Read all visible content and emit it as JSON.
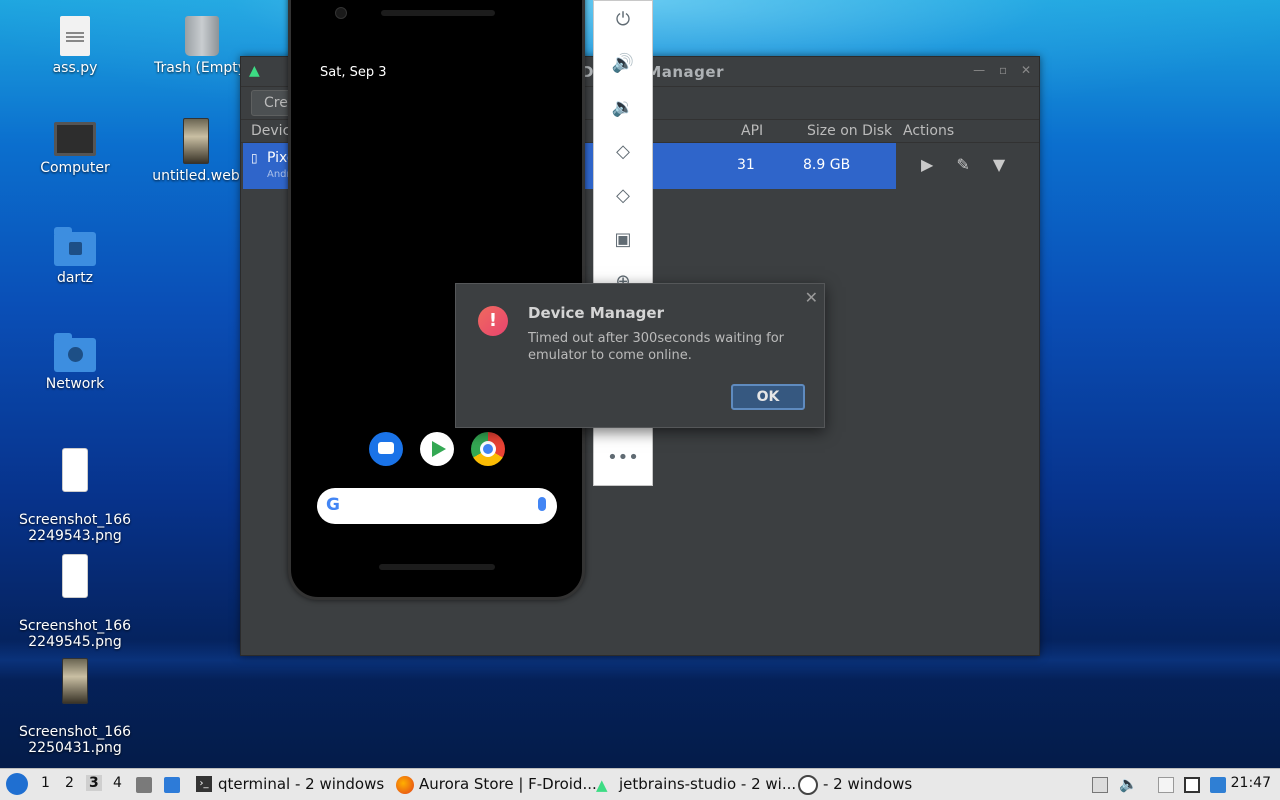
{
  "desktop": {
    "icons": [
      {
        "label": "ass.py"
      },
      {
        "label": "Trash (Empty)"
      },
      {
        "label": "Computer"
      },
      {
        "label": "untitled.web"
      },
      {
        "label": "dartz"
      },
      {
        "label": "Network"
      },
      {
        "label": "Screenshot_166\n2249543.png"
      },
      {
        "label": "Screenshot_166\n2249545.png"
      },
      {
        "label": "Screenshot_166\n2250431.png"
      }
    ]
  },
  "device_manager": {
    "title": "Device Manager",
    "create_label": "Create device",
    "columns": [
      "Device",
      "API",
      "Size on Disk",
      "Actions"
    ],
    "row": {
      "device": "Pixel",
      "subtitle": "Android",
      "api": "31",
      "size": "8.9 GB"
    }
  },
  "emulator": {
    "date": "Sat, Sep 3",
    "tools": [
      "power-icon",
      "volume-up-icon",
      "volume-down-icon",
      "rotate-left-icon",
      "rotate-right-icon",
      "camera-icon",
      "zoom-icon",
      "more-icon"
    ]
  },
  "dialog": {
    "title": "Device Manager",
    "message": "Timed out after 300seconds waiting for emulator to come online.",
    "ok_label": "OK"
  },
  "taskbar": {
    "workspaces": [
      "1",
      "2",
      "3",
      "4"
    ],
    "active_workspace": "3",
    "tasks": [
      {
        "label": "qterminal - 2 windows"
      },
      {
        "label": "Aurora Store | F-Droid..."
      },
      {
        "label": "jetbrains-studio - 2 wi..."
      },
      {
        "label": "- 2 windows"
      }
    ],
    "clock": "21:47"
  }
}
